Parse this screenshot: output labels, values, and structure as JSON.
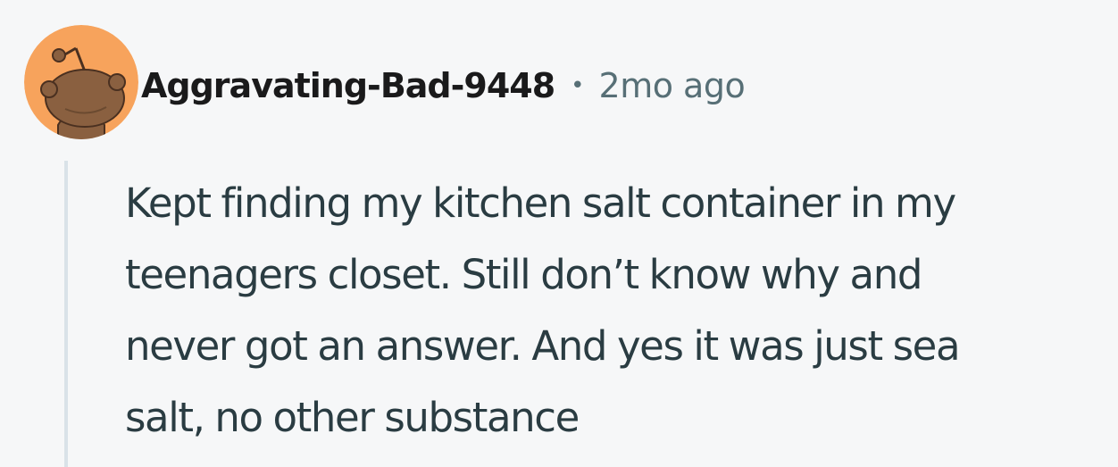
{
  "comment": {
    "author": "Aggravating-Bad-9448",
    "separator": "•",
    "timestamp": "2mo ago",
    "avatar_icon": "snoo-avatar-icon",
    "body_lines": [
      "Kept finding my kitchen salt container in my",
      "teenagers closet. Still don’t know why and",
      "never got an answer. And yes it was just sea",
      "salt, no other substance"
    ]
  },
  "colors": {
    "background": "#f6f7f8",
    "avatar_bg": "#f7a35c",
    "username": "#1a1a1b",
    "meta": "#576f76",
    "body_text": "#2a3c42",
    "thread_line": "#d9e2e8"
  }
}
